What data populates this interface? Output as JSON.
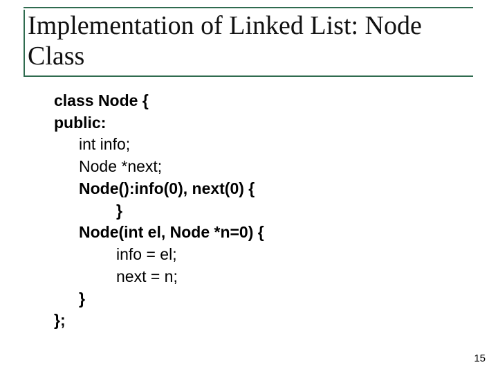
{
  "title": "Implementation of Linked List: Node Class",
  "code": {
    "l1": "class Node {",
    "l2": "public:",
    "l3": "int info;",
    "l4": "Node *next;",
    "l5": "Node():info(0), next(0) {",
    "l6": "}",
    "l7": "Node(int el, Node *n=0) {",
    "l8": "info = el;",
    "l9": "next = n;",
    "l10": "}",
    "l11": "};"
  },
  "page_number": "15"
}
